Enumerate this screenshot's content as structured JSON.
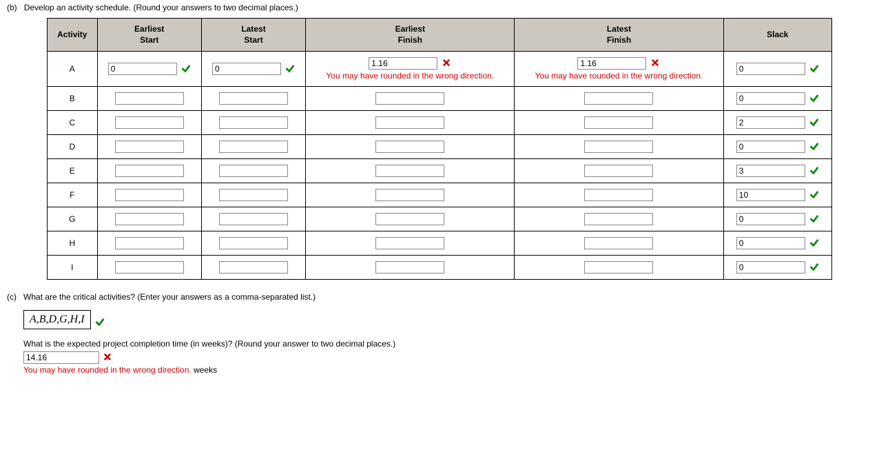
{
  "partB": {
    "label": "(b)",
    "prompt": "Develop an activity schedule. (Round your answers to two decimal places.)",
    "headers": {
      "activity": "Activity",
      "earliestStart": "Earliest\nStart",
      "latestStart": "Latest\nStart",
      "earliestFinish": "Earliest\nFinish",
      "latestFinish": "Latest\nFinish",
      "slack": "Slack"
    },
    "rows": [
      {
        "activity": "A",
        "es": {
          "value": "0",
          "status": "correct"
        },
        "ls": {
          "value": "0",
          "status": "correct"
        },
        "ef": {
          "value": "1.16",
          "status": "incorrect",
          "feedback": "You may have rounded in the wrong direction."
        },
        "lf": {
          "value": "1.16",
          "status": "incorrect",
          "feedback": "You may have rounded in the wrong direction."
        },
        "slack": {
          "value": "0",
          "status": "correct"
        }
      },
      {
        "activity": "B",
        "es": {
          "value": "",
          "status": "none"
        },
        "ls": {
          "value": "",
          "status": "none"
        },
        "ef": {
          "value": "",
          "status": "none"
        },
        "lf": {
          "value": "",
          "status": "none"
        },
        "slack": {
          "value": "0",
          "status": "correct"
        }
      },
      {
        "activity": "C",
        "es": {
          "value": "",
          "status": "none"
        },
        "ls": {
          "value": "",
          "status": "none"
        },
        "ef": {
          "value": "",
          "status": "none"
        },
        "lf": {
          "value": "",
          "status": "none"
        },
        "slack": {
          "value": "2",
          "status": "correct"
        }
      },
      {
        "activity": "D",
        "es": {
          "value": "",
          "status": "none"
        },
        "ls": {
          "value": "",
          "status": "none"
        },
        "ef": {
          "value": "",
          "status": "none"
        },
        "lf": {
          "value": "",
          "status": "none"
        },
        "slack": {
          "value": "0",
          "status": "correct"
        }
      },
      {
        "activity": "E",
        "es": {
          "value": "",
          "status": "none"
        },
        "ls": {
          "value": "",
          "status": "none"
        },
        "ef": {
          "value": "",
          "status": "none"
        },
        "lf": {
          "value": "",
          "status": "none"
        },
        "slack": {
          "value": "3",
          "status": "correct"
        }
      },
      {
        "activity": "F",
        "es": {
          "value": "",
          "status": "none"
        },
        "ls": {
          "value": "",
          "status": "none"
        },
        "ef": {
          "value": "",
          "status": "none"
        },
        "lf": {
          "value": "",
          "status": "none"
        },
        "slack": {
          "value": "10",
          "status": "correct"
        }
      },
      {
        "activity": "G",
        "es": {
          "value": "",
          "status": "none"
        },
        "ls": {
          "value": "",
          "status": "none"
        },
        "ef": {
          "value": "",
          "status": "none"
        },
        "lf": {
          "value": "",
          "status": "none"
        },
        "slack": {
          "value": "0",
          "status": "correct"
        }
      },
      {
        "activity": "H",
        "es": {
          "value": "",
          "status": "none"
        },
        "ls": {
          "value": "",
          "status": "none"
        },
        "ef": {
          "value": "",
          "status": "none"
        },
        "lf": {
          "value": "",
          "status": "none"
        },
        "slack": {
          "value": "0",
          "status": "correct"
        }
      },
      {
        "activity": "I",
        "es": {
          "value": "",
          "status": "none"
        },
        "ls": {
          "value": "",
          "status": "none"
        },
        "ef": {
          "value": "",
          "status": "none"
        },
        "lf": {
          "value": "",
          "status": "none"
        },
        "slack": {
          "value": "0",
          "status": "correct"
        }
      }
    ]
  },
  "partC": {
    "label": "(c)",
    "criticalPrompt": "What are the critical activities? (Enter your answers as a comma-separated list.)",
    "criticalAnswer": "A,B,D,G,H,I",
    "criticalStatus": "correct",
    "completionPrompt": "What is the expected project completion time (in weeks)? (Round your answer to two decimal places.)",
    "completionValue": "14.16",
    "completionStatus": "incorrect",
    "completionFeedback": "You may have rounded in the wrong direction.",
    "completionUnit": "weeks"
  }
}
